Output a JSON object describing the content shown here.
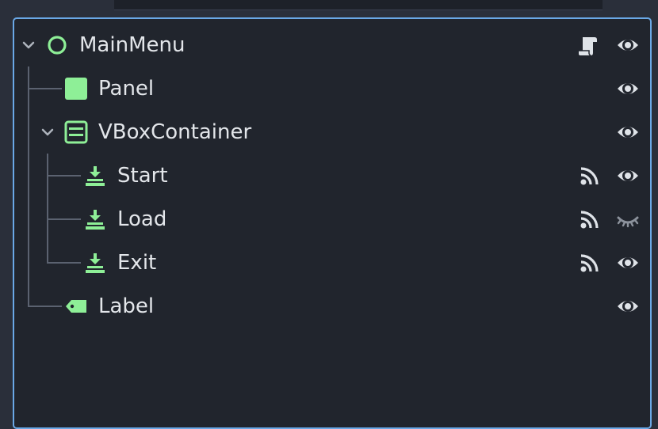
{
  "scene_tree": {
    "nodes": [
      {
        "label": "MainMenu",
        "type_icon": "circle-node-icon",
        "expanded": true,
        "has_script": true,
        "has_signals": false,
        "visible": true
      },
      {
        "label": "Panel",
        "type_icon": "panel-icon",
        "expanded": false,
        "has_script": false,
        "has_signals": false,
        "visible": true
      },
      {
        "label": "VBoxContainer",
        "type_icon": "vbox-container-icon",
        "expanded": true,
        "has_script": false,
        "has_signals": false,
        "visible": true
      },
      {
        "label": "Start",
        "type_icon": "button-icon",
        "expanded": false,
        "has_script": false,
        "has_signals": true,
        "visible": true
      },
      {
        "label": "Load",
        "type_icon": "button-icon",
        "expanded": false,
        "has_script": false,
        "has_signals": true,
        "visible": false
      },
      {
        "label": "Exit",
        "type_icon": "button-icon",
        "expanded": false,
        "has_script": false,
        "has_signals": true,
        "visible": true
      },
      {
        "label": "Label",
        "type_icon": "label-tag-icon",
        "expanded": false,
        "has_script": false,
        "has_signals": false,
        "visible": true
      }
    ]
  },
  "colors": {
    "node_icon_green": "#8eef97",
    "text": "#e3e6ea",
    "icon_light": "#dfe3e8",
    "panel_bg": "#21252d",
    "focus_border": "#6aa8e6",
    "guide_line": "#5b6270"
  }
}
